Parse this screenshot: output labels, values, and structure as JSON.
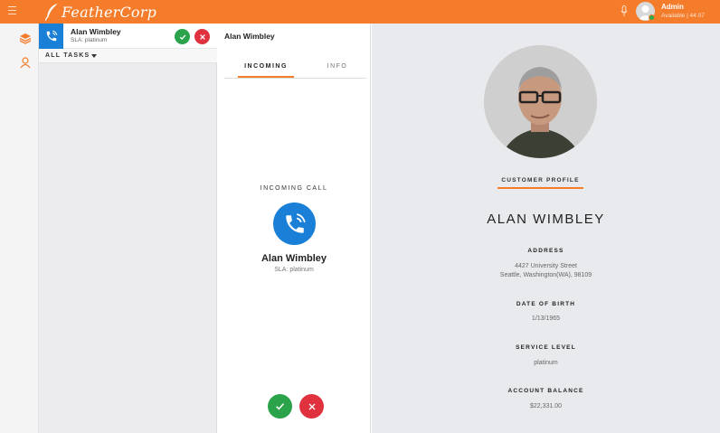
{
  "topbar": {
    "brand": "FeatherCorp",
    "user_name": "Admin",
    "user_status": "Available | 44:07"
  },
  "task": {
    "caller_name": "Alan Wimbley",
    "sla": "SLA: platinum"
  },
  "task_filter": {
    "label": "ALL TASKS"
  },
  "call": {
    "title": "Alan Wimbley",
    "tabs": [
      {
        "label": "INCOMING"
      },
      {
        "label": "INFO"
      }
    ],
    "status_label": "INCOMING CALL",
    "caller_name": "Alan Wimbley",
    "sla": "SLA: platinum"
  },
  "profile": {
    "tab_label": "CUSTOMER PROFILE",
    "name": "ALAN WIMBLEY",
    "fields": [
      {
        "label": "ADDRESS",
        "lines": [
          "4427 University Street",
          "Seattle, Washington(WA), 98109"
        ]
      },
      {
        "label": "DATE OF BIRTH",
        "lines": [
          "1/13/1965"
        ]
      },
      {
        "label": "SERVICE LEVEL",
        "lines": [
          "platinum"
        ]
      },
      {
        "label": "ACCOUNT BALANCE",
        "lines": [
          "$22,331.00"
        ]
      }
    ]
  },
  "colors": {
    "brand_orange": "#f47c2a",
    "accept_green": "#2aa34a",
    "reject_red": "#e0323e",
    "channel_blue": "#1a7fd6"
  },
  "icons": {
    "menu": "hamburger-icon",
    "brand": "feather-icon",
    "mic": "microphone-icon",
    "nav_tasks": "layers-icon",
    "nav_directory": "contacts-icon",
    "channel": "phone-ringing-icon",
    "accept": "check-icon",
    "reject": "close-icon"
  }
}
